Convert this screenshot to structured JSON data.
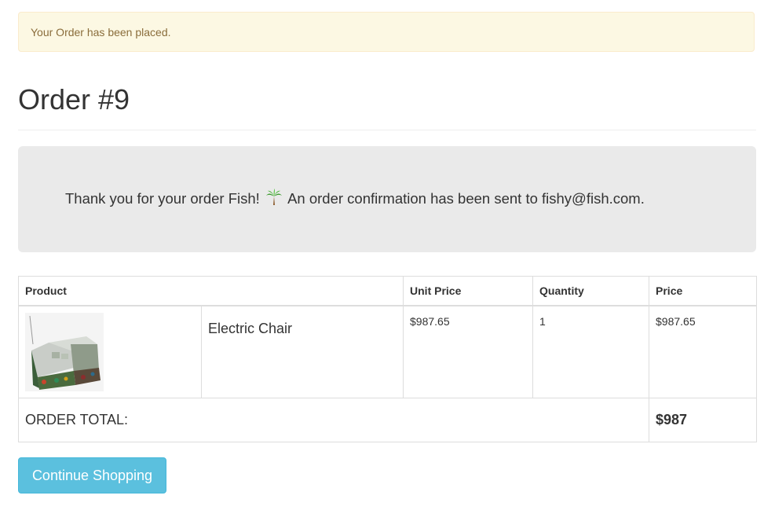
{
  "alert": {
    "message": "Your Order has been placed."
  },
  "order": {
    "title": "Order #9",
    "confirmation_text_before": "Thank you for your order Fish! ",
    "confirmation_icon": "palm-tree-icon",
    "confirmation_text_after": " An order confirmation has been sent to fishy@fish.com."
  },
  "table": {
    "headers": {
      "product": "Product",
      "unit_price": "Unit Price",
      "quantity": "Quantity",
      "price": "Price"
    },
    "rows": [
      {
        "image": "electric-chair-image",
        "name": "Electric Chair",
        "unit_price": "$987.65",
        "quantity": "1",
        "price": "$987.65"
      }
    ],
    "total_label": "ORDER TOTAL:",
    "total_value": "$987"
  },
  "actions": {
    "continue_label": "Continue Shopping"
  },
  "colors": {
    "alert_bg": "#fcf8e3",
    "alert_text": "#8a6d3b",
    "jumbotron_bg": "#eaeaea",
    "button_bg": "#5bc0de"
  }
}
